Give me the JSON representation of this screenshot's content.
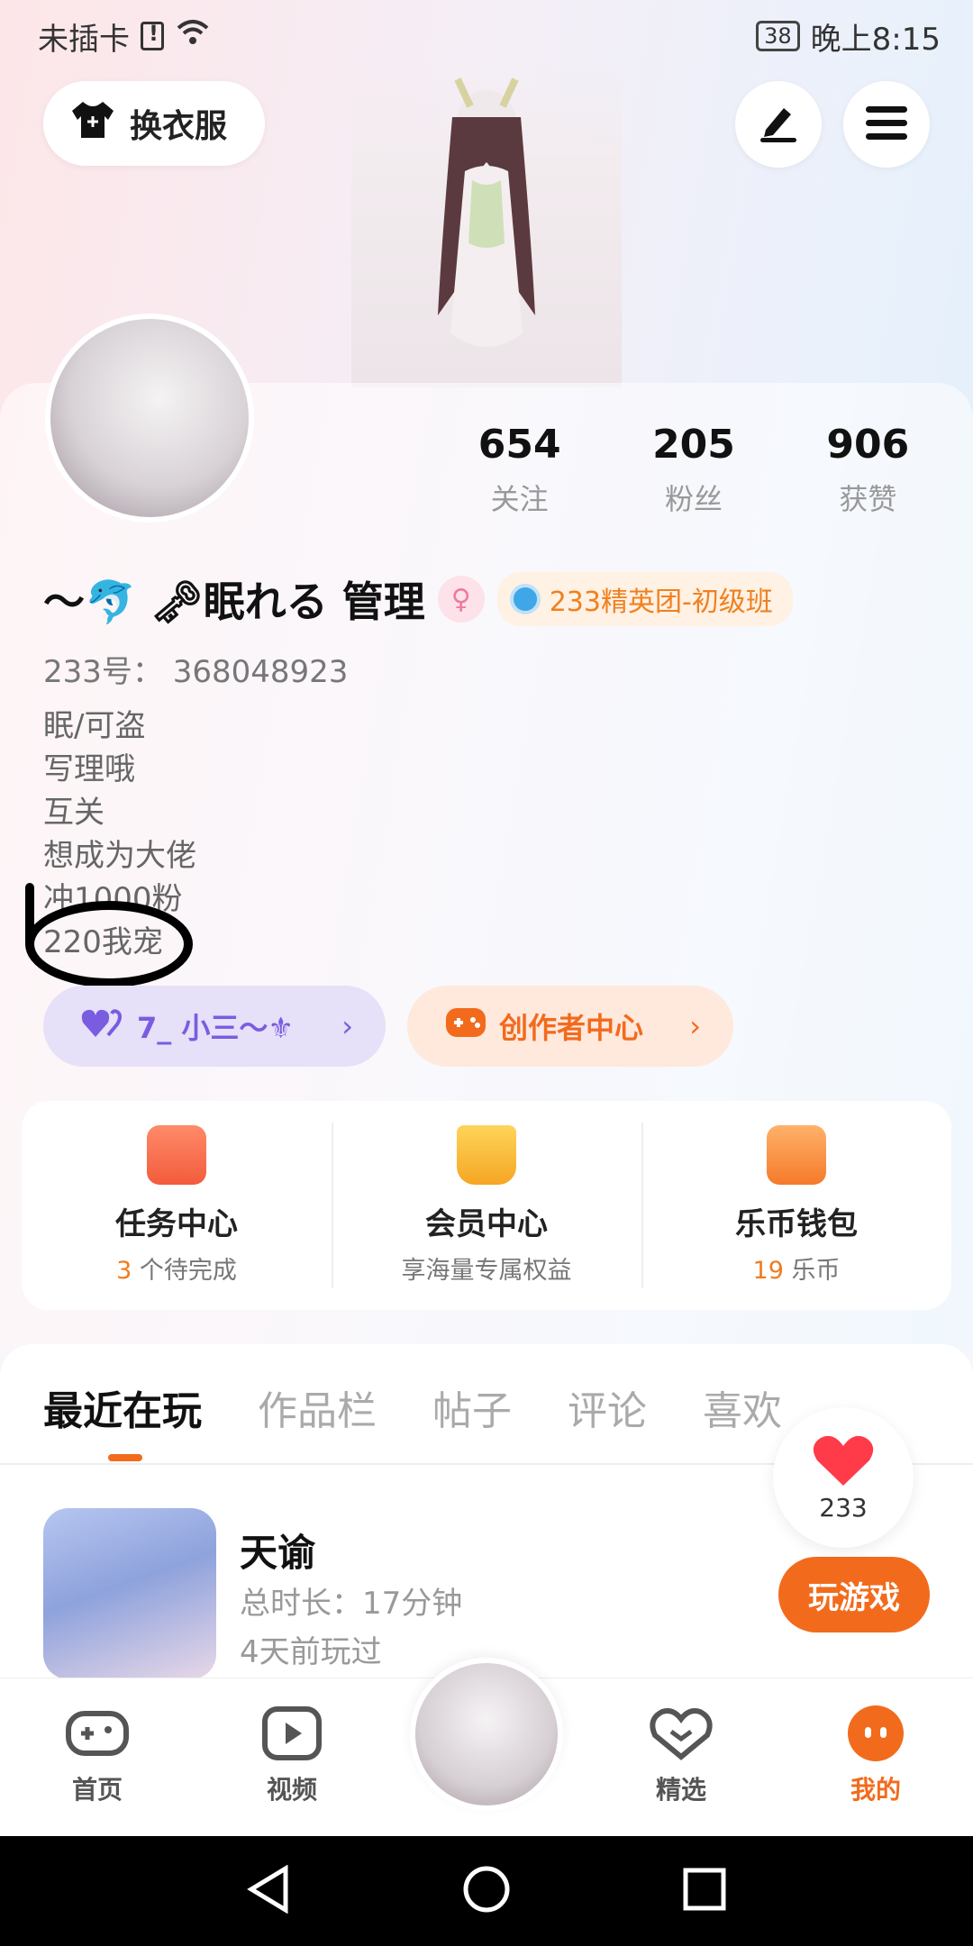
{
  "status_bar": {
    "carrier": "未插卡",
    "battery": "38",
    "time": "晚上8:15"
  },
  "top_actions": {
    "change_clothes": "换衣服"
  },
  "stats": [
    {
      "value": "654",
      "label": "关注"
    },
    {
      "value": "205",
      "label": "粉丝"
    },
    {
      "value": "906",
      "label": "获赞"
    }
  ],
  "profile": {
    "name": "〜🐬 🗝眠れる  管理",
    "club": "233精英团-初级班",
    "user_id": "233号：  368048923",
    "bio": [
      "眠/可盗",
      "写理哦",
      "互关",
      "想成为大佬",
      "冲1000粉",
      "220我宠"
    ]
  },
  "chips": {
    "fan_group": "7_ 小三～⚜",
    "creator": "创作者中心"
  },
  "services": [
    {
      "title": "任务中心",
      "highlight": "3",
      "sub": " 个待完成"
    },
    {
      "title": "会员中心",
      "highlight": "",
      "sub": "享海量专属权益"
    },
    {
      "title": "乐币钱包",
      "highlight": "19",
      "sub": " 乐币"
    }
  ],
  "tabs": [
    "最近在玩",
    "作品栏",
    "帖子",
    "评论",
    "喜欢"
  ],
  "like_float": {
    "count": "233"
  },
  "recent_game": {
    "title": "天谕",
    "duration": "总时长：17分钟",
    "last_played": "4天前玩过",
    "play_label": "玩游戏"
  },
  "bottom_nav": [
    {
      "label": "首页",
      "icon": "gamepad-icon"
    },
    {
      "label": "视频",
      "icon": "video-icon"
    },
    {
      "label": "精选",
      "icon": "heart-chat-icon"
    },
    {
      "label": "我的",
      "icon": "profile-face-icon"
    }
  ],
  "colors": {
    "accent": "#f26b1d",
    "fan_chip": "#7a5ce0",
    "creator_chip": "#f26b1d"
  }
}
